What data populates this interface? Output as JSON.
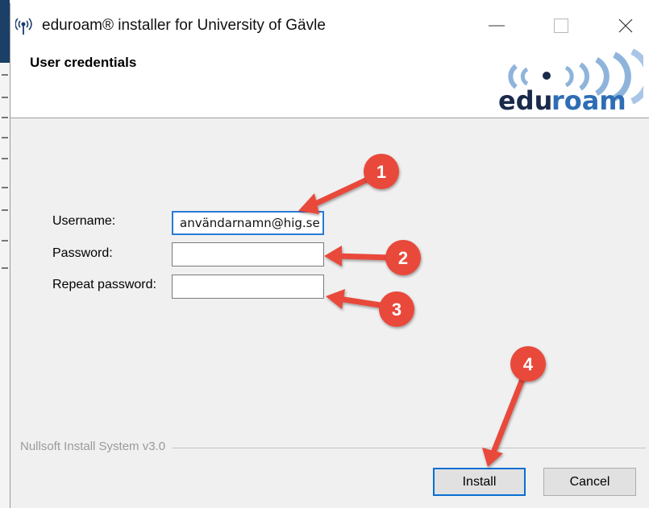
{
  "window": {
    "title": "eduroam® installer for University of Gävle"
  },
  "header": {
    "title": "User credentials",
    "logo_text": "eduroam",
    "logo_colors": {
      "edu": "#1a2a4a",
      "roam": "#2e6db4",
      "waves": "#8fb4db"
    }
  },
  "form": {
    "username_label": "Username:",
    "username_value": "användarnamn@hig.se",
    "password_label": "Password:",
    "password_value": "",
    "repeat_label": "Repeat password:",
    "repeat_value": ""
  },
  "footer": {
    "branding": "Nullsoft Install System v3.0",
    "install_label": "Install",
    "cancel_label": "Cancel"
  },
  "annotations": {
    "badges": [
      "1",
      "2",
      "3",
      "4"
    ],
    "color": "#e8483a"
  }
}
